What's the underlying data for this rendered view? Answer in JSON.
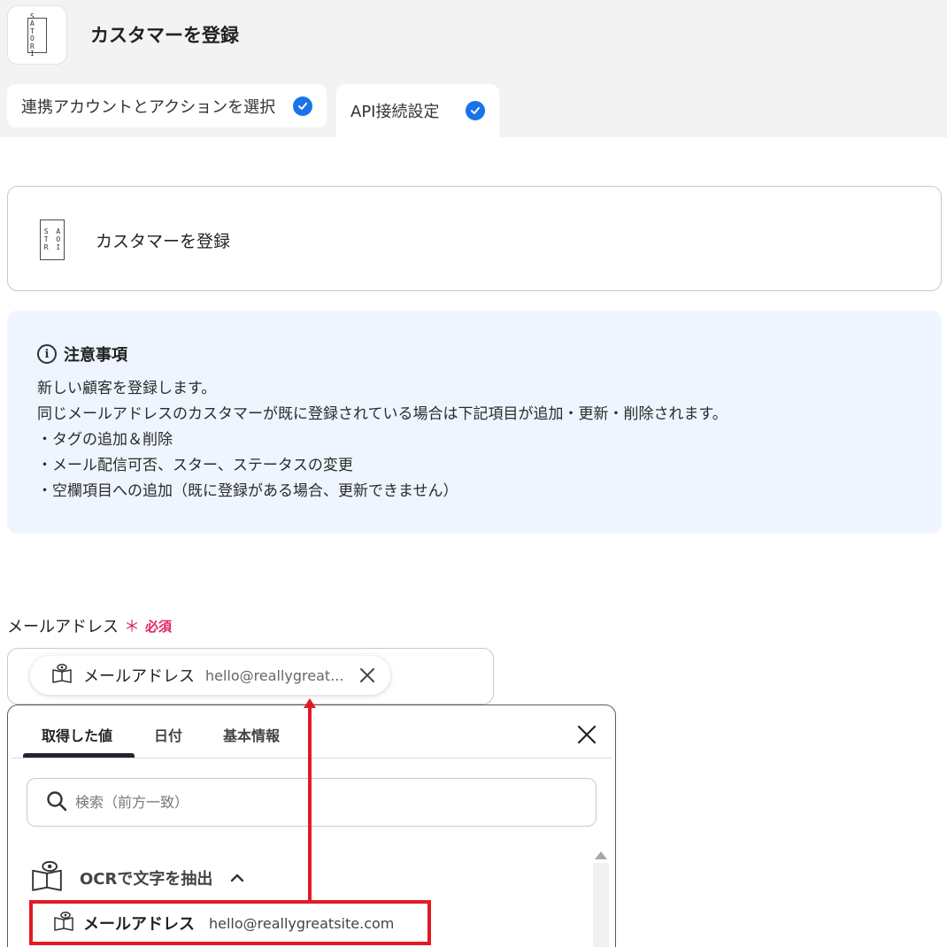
{
  "header": {
    "app_logo_text": [
      "S A",
      "T O",
      "R I"
    ],
    "title": "カスタマーを登録"
  },
  "tabs": [
    {
      "label": "連携アカウントとアクションを選択",
      "status": "completed"
    },
    {
      "label": "API接続設定",
      "status": "completed"
    }
  ],
  "action_card": {
    "title": "カスタマーを登録"
  },
  "notice": {
    "heading": "注意事項",
    "lines": [
      "新しい顧客を登録します。",
      "同じメールアドレスのカスタマーが既に登録されている場合は下記項目が追加・更新・削除されます。",
      "・タグの追加＆削除",
      "・メール配信可否、スター、ステータスの変更",
      "・空欄項目への追加（既に登録がある場合、更新できません）"
    ]
  },
  "email_field": {
    "label": "メールアドレス",
    "required_mark": "＊",
    "required_text": "必須",
    "chip": {
      "label": "メールアドレス",
      "value": "hello@reallygreat..."
    }
  },
  "picker": {
    "tabs": [
      "取得した値",
      "日付",
      "基本情報"
    ],
    "active_tab": 0,
    "search_placeholder": "検索（前方一致）",
    "group": {
      "label": "OCRで文字を抽出",
      "expanded": true
    },
    "item": {
      "label": "メールアドレス",
      "value": "hello@reallygreatsite.com"
    }
  },
  "colors": {
    "accent": "#1a73e8",
    "required": "#e0245e",
    "highlight": "#e21a26",
    "notice_bg": "#eef5fe"
  }
}
